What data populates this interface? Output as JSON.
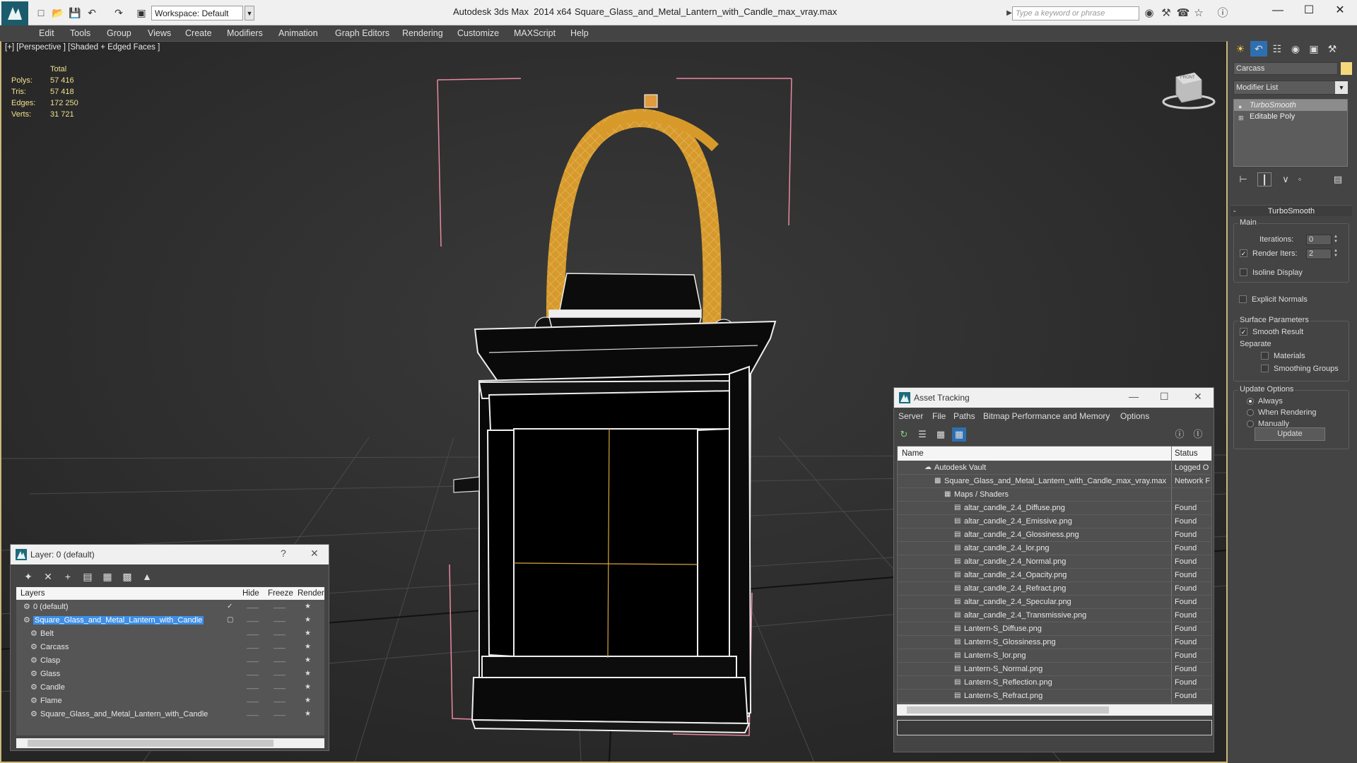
{
  "titlebar": {
    "app_title": "Autodesk 3ds Max  2014 x64",
    "file_title": "Square_Glass_and_Metal_Lantern_with_Candle_max_vray.max",
    "workspace": "Workspace: Default",
    "search_placeholder": "Type a keyword or phrase"
  },
  "menu": [
    "Edit",
    "Tools",
    "Group",
    "Views",
    "Create",
    "Modifiers",
    "Animation",
    "Graph Editors",
    "Rendering",
    "Customize",
    "MAXScript",
    "Help"
  ],
  "viewport": {
    "label": "[+] [Perspective ] [Shaded + Edged Faces ]",
    "stats": {
      "header": "Total",
      "polys_label": "Polys:",
      "polys": "57 416",
      "tris_label": "Tris:",
      "tris": "57 418",
      "edges_label": "Edges:",
      "edges": "172 250",
      "verts_label": "Verts:",
      "verts": "31 721"
    },
    "viewcube_label": "FRONT"
  },
  "command_panel": {
    "object_name": "Carcass",
    "object_color": "#f5d87c",
    "modifier_list": "Modifier List",
    "stack": [
      "TurboSmooth",
      "Editable Poly"
    ],
    "rollout_title": "TurboSmooth",
    "main_group": "Main",
    "iterations_label": "Iterations:",
    "iterations": "0",
    "render_iters_label": "Render Iters:",
    "render_iters": "2",
    "isoline": "Isoline Display",
    "explicit_normals": "Explicit Normals",
    "surface_group": "Surface Parameters",
    "smooth_result": "Smooth Result",
    "separate": "Separate",
    "materials": "Materials",
    "smoothing_groups": "Smoothing Groups",
    "update_group": "Update Options",
    "always": "Always",
    "when_rendering": "When Rendering",
    "manually": "Manually",
    "update_button": "Update"
  },
  "layer_window": {
    "title": "Layer: 0 (default)",
    "help": "?",
    "columns": {
      "layers": "Layers",
      "hide": "Hide",
      "freeze": "Freeze",
      "render": "Render"
    },
    "rows": [
      {
        "name": "0 (default)",
        "indent": 0
      },
      {
        "name": "Square_Glass_and_Metal_Lantern_with_Candle",
        "indent": 0,
        "selected": true
      },
      {
        "name": "Belt",
        "indent": 1
      },
      {
        "name": "Carcass",
        "indent": 1
      },
      {
        "name": "Clasp",
        "indent": 1
      },
      {
        "name": "Glass",
        "indent": 1
      },
      {
        "name": "Candle",
        "indent": 1
      },
      {
        "name": "Flame",
        "indent": 1
      },
      {
        "name": "Square_Glass_and_Metal_Lantern_with_Candle",
        "indent": 1
      }
    ]
  },
  "asset_window": {
    "title": "Asset Tracking",
    "menu": [
      "Server",
      "File",
      "Paths",
      "Bitmap Performance and Memory",
      "Options"
    ],
    "columns": {
      "name": "Name",
      "status": "Status"
    },
    "rows": [
      {
        "name": "Autodesk Vault",
        "status": "Logged O",
        "indent": 1
      },
      {
        "name": "Square_Glass_and_Metal_Lantern_with_Candle_max_vray.max",
        "status": "Network F",
        "indent": 2
      },
      {
        "name": "Maps / Shaders",
        "status": "",
        "indent": 3
      },
      {
        "name": "altar_candle_2.4_Diffuse.png",
        "status": "Found",
        "indent": 4
      },
      {
        "name": "altar_candle_2.4_Emissive.png",
        "status": "Found",
        "indent": 4
      },
      {
        "name": "altar_candle_2.4_Glossiness.png",
        "status": "Found",
        "indent": 4
      },
      {
        "name": "altar_candle_2.4_lor.png",
        "status": "Found",
        "indent": 4
      },
      {
        "name": "altar_candle_2.4_Normal.png",
        "status": "Found",
        "indent": 4
      },
      {
        "name": "altar_candle_2.4_Opacity.png",
        "status": "Found",
        "indent": 4
      },
      {
        "name": "altar_candle_2.4_Refract.png",
        "status": "Found",
        "indent": 4
      },
      {
        "name": "altar_candle_2.4_Specular.png",
        "status": "Found",
        "indent": 4
      },
      {
        "name": "altar_candle_2.4_Transmissive.png",
        "status": "Found",
        "indent": 4
      },
      {
        "name": "Lantern-S_Diffuse.png",
        "status": "Found",
        "indent": 4
      },
      {
        "name": "Lantern-S_Glossiness.png",
        "status": "Found",
        "indent": 4
      },
      {
        "name": "Lantern-S_lor.png",
        "status": "Found",
        "indent": 4
      },
      {
        "name": "Lantern-S_Normal.png",
        "status": "Found",
        "indent": 4
      },
      {
        "name": "Lantern-S_Reflection.png",
        "status": "Found",
        "indent": 4
      },
      {
        "name": "Lantern-S_Refract.png",
        "status": "Found",
        "indent": 4
      }
    ]
  }
}
